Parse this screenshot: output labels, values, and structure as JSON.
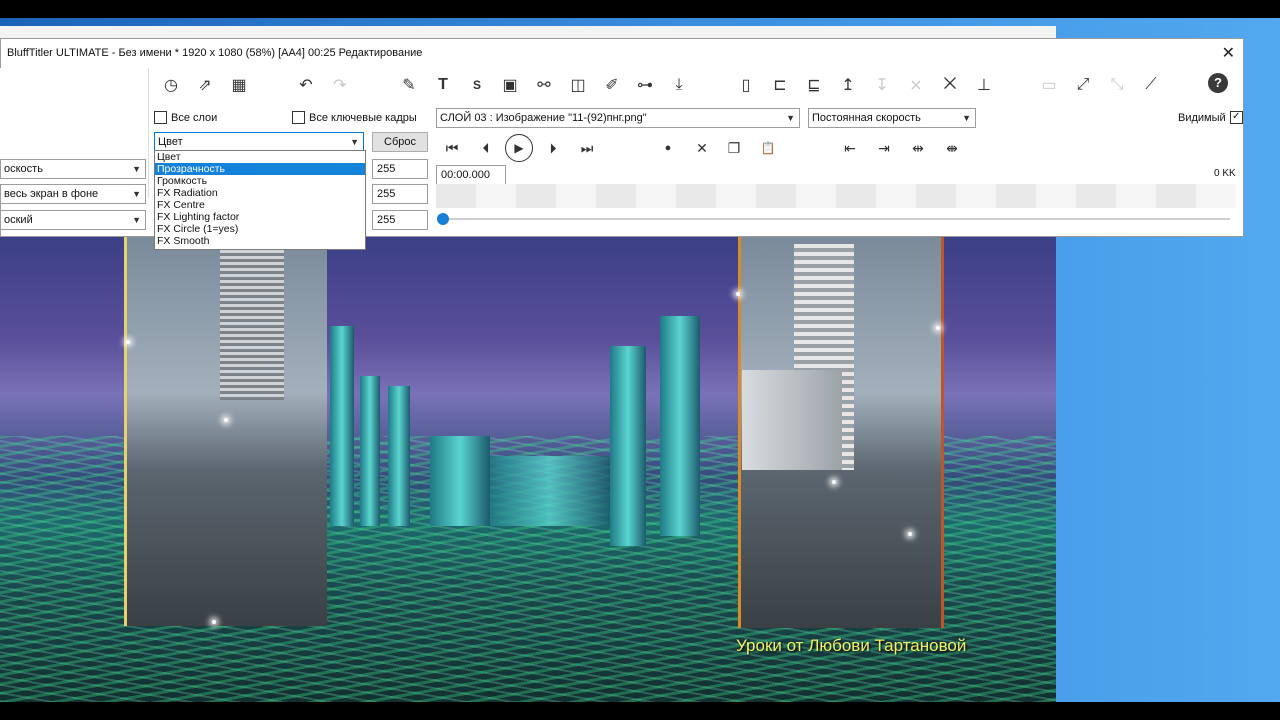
{
  "window": {
    "title": "BluffTitler ULTIMATE  - Без имени * 1920 x 1080 (58%) [AA4] 00:25 Редактирование",
    "close_glyph": "✕"
  },
  "toolbar": {
    "icons": [
      "plus-circle-icon",
      "open-folder-icon",
      "crop-icon",
      "clock-icon",
      "export-icon",
      "film-icon",
      "undo-icon",
      "redo-icon",
      "brush-icon",
      "text-icon",
      "s-icon",
      "image-icon",
      "nodes-icon",
      "cube-icon",
      "pencil-icon",
      "shapes-icon",
      "download-icon",
      "layers-icon",
      "layer-child-icon",
      "layer-link-icon",
      "layer-up-icon",
      "layer-x-icon",
      "layer-down-icon",
      "frame-icon",
      "transform-icon",
      "magic-wand-icon",
      "help-icon"
    ],
    "undo_glyph": "↶",
    "redo_glyph": "↷",
    "help_glyph": "?"
  },
  "controls": {
    "all_layers_label": "Все слои",
    "all_keyframes_label": "Все ключевые кадры",
    "property_combo": "Цвет",
    "reset_label": "Сброс",
    "values": [
      "255",
      "255",
      "255"
    ],
    "layer_combo": "СЛОЙ 03            : Изображение \"11-(92)пнг.png\"",
    "speed_combo": "Постоянная скорость",
    "visible_label": "Видимый",
    "visible_checked": "✓",
    "time_value": "00:00.000",
    "counter": "0 KK",
    "left_combos": [
      "оскость",
      "весь экран в фоне",
      "оский"
    ]
  },
  "dropdown": {
    "options": [
      "Цвет",
      "Прозрачность",
      "Громкость",
      "FX Radiation",
      "FX Centre",
      "FX Lighting factor",
      "FX Circle (1=yes)",
      "FX Smooth"
    ],
    "selected_index": 1
  },
  "player": {
    "buttons": [
      "⏮",
      "⏴",
      "▶",
      "⏵",
      "⏭",
      "●",
      "✕",
      "❐",
      "📋",
      "⇤",
      "⇥",
      "⇹",
      "⇼"
    ]
  },
  "scene": {
    "caption": "Уроки от Любови Тартановой"
  }
}
